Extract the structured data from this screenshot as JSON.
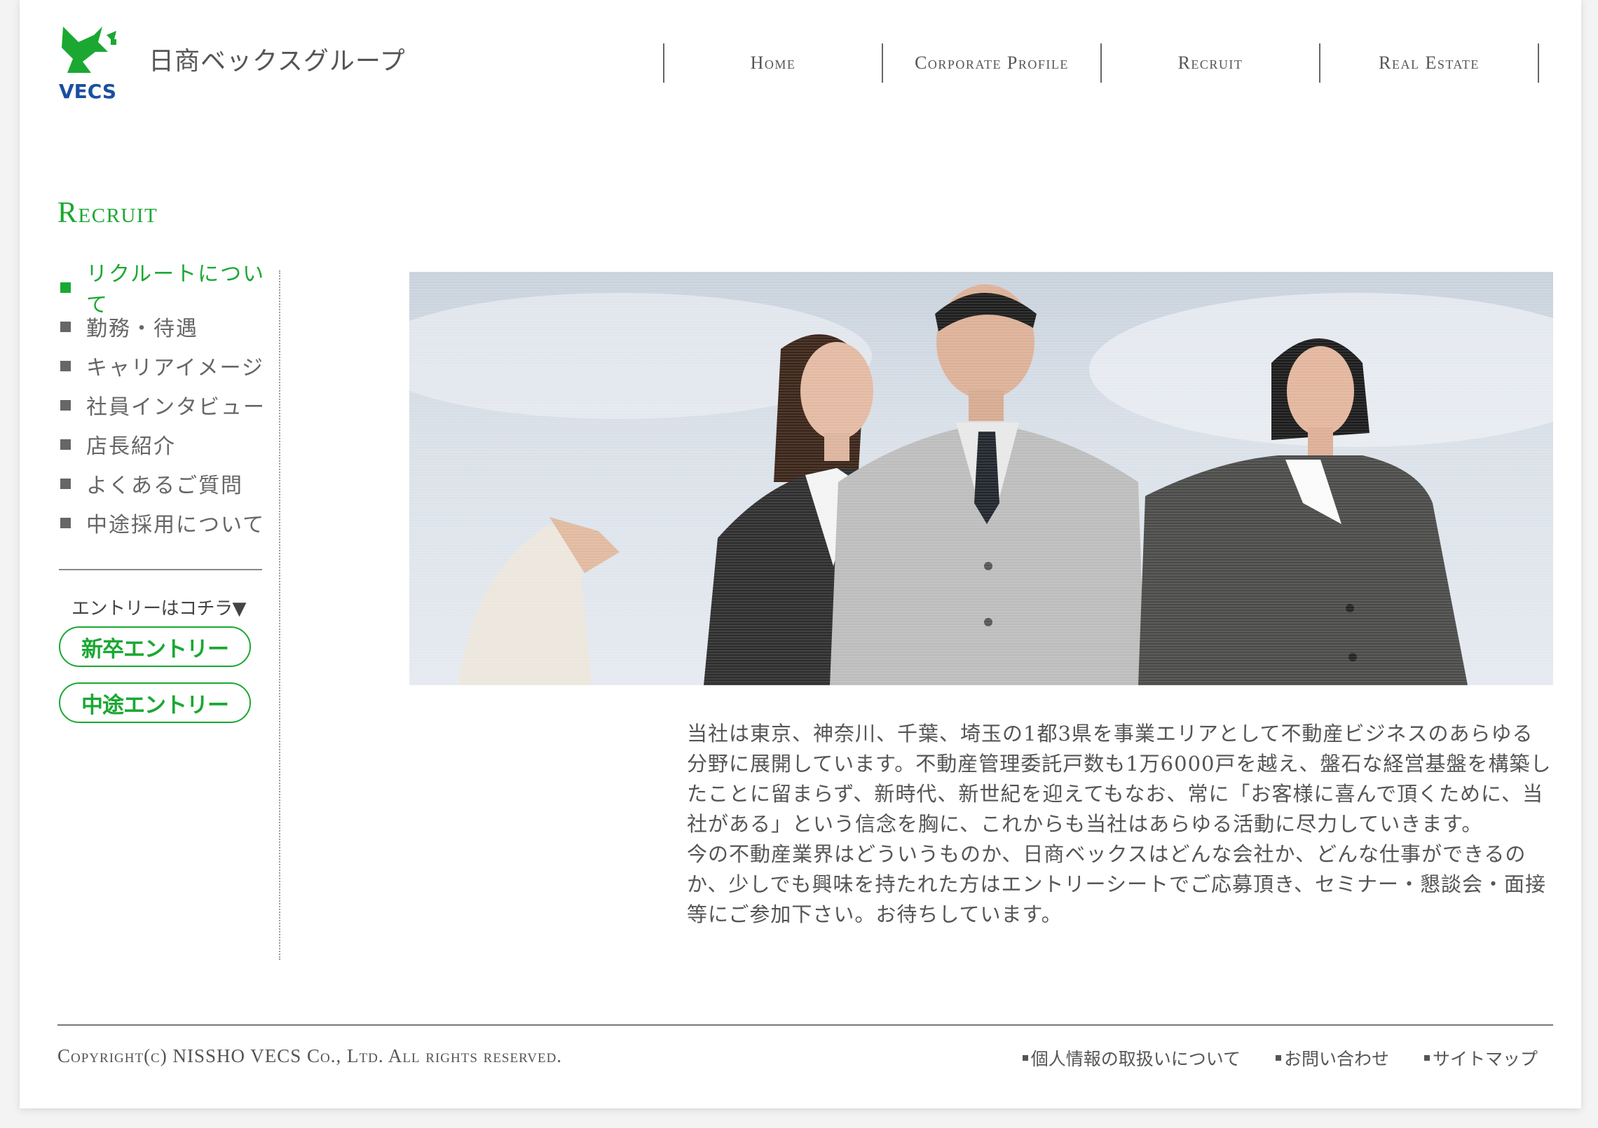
{
  "header": {
    "logo_text": "VECS",
    "group_name": "日商ベックスグループ",
    "nav": [
      {
        "label": "Home"
      },
      {
        "label": "Corporate Profile"
      },
      {
        "label": "Recruit"
      },
      {
        "label": "Real Estate"
      }
    ]
  },
  "section": {
    "title": "Recruit"
  },
  "sidebar": {
    "items": [
      {
        "label": "リクルートについて",
        "active": true
      },
      {
        "label": "勤務・待遇"
      },
      {
        "label": "キャリアイメージ"
      },
      {
        "label": "社員インタビュー"
      },
      {
        "label": "店長紹介"
      },
      {
        "label": "よくあるご質問"
      },
      {
        "label": "中途採用について"
      }
    ],
    "entry_caption": "エントリーはコチラ▼",
    "entry_new_grad": "新卒エントリー",
    "entry_mid_career": "中途エントリー"
  },
  "main": {
    "paragraph1": "当社は東京、神奈川、千葉、埼玉の1都3県を事業エリアとして不動産ビジネスのあらゆる分野に展開しています。不動産管理委託戸数も1万6000戸を越え、盤石な経営基盤を構築したことに留まらず、新時代、新世紀を迎えてもなお、常に「お客様に喜んで頂くために、当社がある」という信念を胸に、これからも当社はあらゆる活動に尽力していきます。",
    "paragraph2": "今の不動産業界はどういうものか、日商ベックスはどんな会社か、どんな仕事ができるのか、少しでも興味を持たれた方はエントリーシートでご応募頂き、セミナー・懇談会・面接等にご参加下さい。お待ちしています。"
  },
  "footer": {
    "copyright": "Copyright(c) NISSHO VECS Co., Ltd. All rights reserved.",
    "links": [
      {
        "label": "個人情報の取扱いについて"
      },
      {
        "label": "お問い合わせ"
      },
      {
        "label": "サイトマップ"
      }
    ]
  },
  "colors": {
    "accent": "#1aa832",
    "text": "#555555"
  }
}
